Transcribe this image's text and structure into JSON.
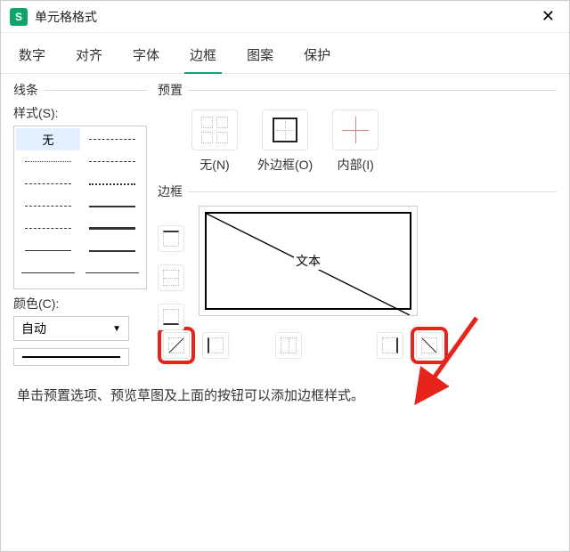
{
  "window": {
    "title": "单元格格式"
  },
  "tabs": [
    "数字",
    "对齐",
    "字体",
    "边框",
    "图案",
    "保护"
  ],
  "active_tab": 3,
  "left": {
    "section": "线条",
    "style_label": "样式(S):",
    "none_label": "无",
    "color_label": "颜色(C):",
    "color_value": "自动"
  },
  "right": {
    "preset_section": "预置",
    "presets": [
      {
        "id": "none",
        "label": "无(N)"
      },
      {
        "id": "outer",
        "label": "外边框(O)"
      },
      {
        "id": "inner",
        "label": "内部(I)"
      }
    ],
    "border_section": "边框",
    "preview_text": "文本"
  },
  "hint": "单击预置选项、预览草图及上面的按钮可以添加边框样式。",
  "annotations": {
    "arrow_color": "#e6241c",
    "highlight_targets": [
      "diagonal-up-button",
      "diagonal-down-button"
    ]
  }
}
